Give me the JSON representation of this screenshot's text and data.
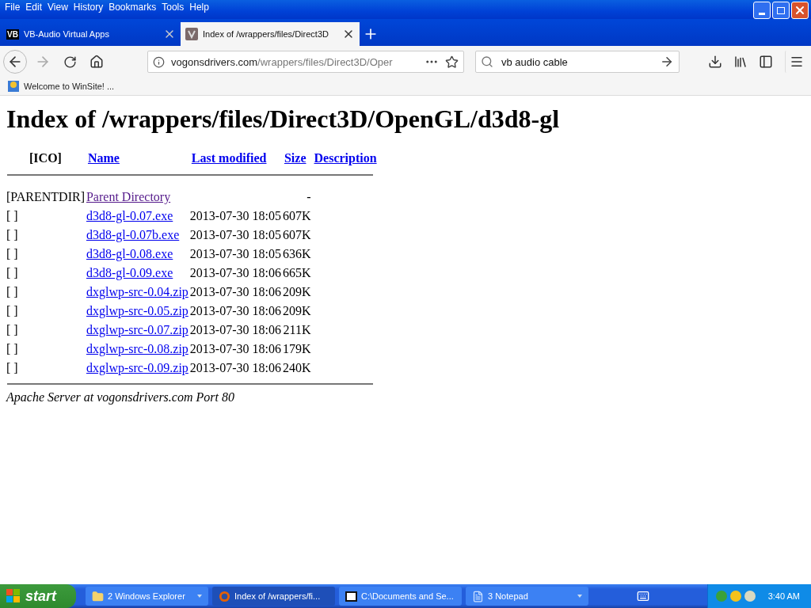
{
  "menu": [
    "File",
    "Edit",
    "View",
    "History",
    "Bookmarks",
    "Tools",
    "Help"
  ],
  "tabs": [
    {
      "label": "VB-Audio Virtual Apps",
      "icon": "VB",
      "selected": false
    },
    {
      "label": "Index of /wrappers/files/Direct3D",
      "selected": true
    }
  ],
  "address": {
    "domain": "vogonsdrivers.com",
    "path": "/wrappers/files/Direct3D/Oper"
  },
  "search": {
    "value": "vb audio cable"
  },
  "bookmarks": [
    {
      "label": "Welcome to WinSite! ..."
    }
  ],
  "page": {
    "heading": "Index of /wrappers/files/Direct3D/OpenGL/d3d8-gl",
    "columns": [
      "[ICO]",
      "Name",
      "Last modified",
      "Size",
      "Description"
    ],
    "rows": [
      {
        "icon": "[PARENTDIR]",
        "name": "Parent Directory",
        "modified": "",
        "size": "-",
        "visited": true
      },
      {
        "icon": "[ ]",
        "name": "d3d8-gl-0.07.exe",
        "modified": "2013-07-30 18:05",
        "size": "607K",
        "visited": false
      },
      {
        "icon": "[ ]",
        "name": "d3d8-gl-0.07b.exe",
        "modified": "2013-07-30 18:05",
        "size": "607K",
        "visited": false
      },
      {
        "icon": "[ ]",
        "name": "d3d8-gl-0.08.exe",
        "modified": "2013-07-30 18:05",
        "size": "636K",
        "visited": false
      },
      {
        "icon": "[ ]",
        "name": "d3d8-gl-0.09.exe",
        "modified": "2013-07-30 18:06",
        "size": "665K",
        "visited": false
      },
      {
        "icon": "[ ]",
        "name": "dxglwp-src-0.04.zip",
        "modified": "2013-07-30 18:06",
        "size": "209K",
        "visited": false
      },
      {
        "icon": "[ ]",
        "name": "dxglwp-src-0.05.zip",
        "modified": "2013-07-30 18:06",
        "size": "209K",
        "visited": false
      },
      {
        "icon": "[ ]",
        "name": "dxglwp-src-0.07.zip",
        "modified": "2013-07-30 18:06",
        "size": "211K",
        "visited": false
      },
      {
        "icon": "[ ]",
        "name": "dxglwp-src-0.08.zip",
        "modified": "2013-07-30 18:06",
        "size": "179K",
        "visited": false
      },
      {
        "icon": "[ ]",
        "name": "dxglwp-src-0.09.zip",
        "modified": "2013-07-30 18:06",
        "size": "240K",
        "visited": false
      }
    ],
    "address_line": "Apache Server at vogonsdrivers.com Port 80"
  },
  "taskbar": {
    "start": "start",
    "buttons": [
      {
        "label": "2 Windows Explorer",
        "kind": "folder",
        "group": true,
        "selected": false
      },
      {
        "label": "Index of /wrappers/fi...",
        "kind": "browser",
        "group": false,
        "selected": true
      },
      {
        "label": "C:\\Documents and Se...",
        "kind": "archive",
        "group": false,
        "selected": false
      },
      {
        "label": "3 Notepad",
        "kind": "notepad",
        "group": true,
        "selected": false
      }
    ],
    "clock": "3:40 AM"
  }
}
